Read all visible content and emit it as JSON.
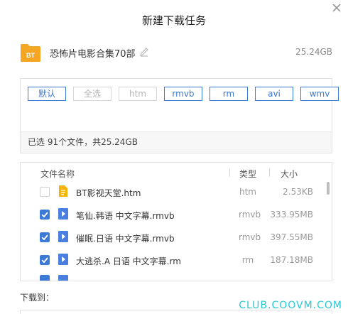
{
  "dialog": {
    "title": "新建下载任务"
  },
  "task": {
    "name": "恐怖片电影合集70部",
    "size": "25.24GB",
    "folder_badge": "BT"
  },
  "filters": [
    {
      "label": "默认",
      "state": "active"
    },
    {
      "label": "全选",
      "state": "disabled"
    },
    {
      "label": "htm",
      "state": "disabled"
    },
    {
      "label": "rmvb",
      "state": "active"
    },
    {
      "label": "rm",
      "state": "active"
    },
    {
      "label": "avi",
      "state": "active"
    },
    {
      "label": "wmv",
      "state": "active"
    }
  ],
  "selection_summary": "已选 91个文件，共25.24GB",
  "table": {
    "headers": {
      "name": "文件名称",
      "type": "类型",
      "size": "大小"
    },
    "rows": [
      {
        "checked": false,
        "icon": "document-icon",
        "name": "BT影视天堂.htm",
        "type": "htm",
        "size": "2.53KB"
      },
      {
        "checked": true,
        "icon": "video-icon",
        "name": "笔仙.韩语 中文字幕.rmvb",
        "type": "rmvb",
        "size": "333.95MB"
      },
      {
        "checked": true,
        "icon": "video-icon",
        "name": "催眠.日语 中文字幕.rmvb",
        "type": "rmvb",
        "size": "397.55MB"
      },
      {
        "checked": true,
        "icon": "video-icon",
        "name": "大逃杀.A 日语 中文字幕.rm",
        "type": "rm",
        "size": "187.18MB"
      }
    ]
  },
  "download_to_label": "下载到：",
  "watermark": "CLUB.COOVM.COM",
  "colors": {
    "accent": "#3b7ad6",
    "folder": "#f5a623",
    "document": "#f5b400",
    "video": "#4a7fe0",
    "watermark": "#28c8d0"
  }
}
